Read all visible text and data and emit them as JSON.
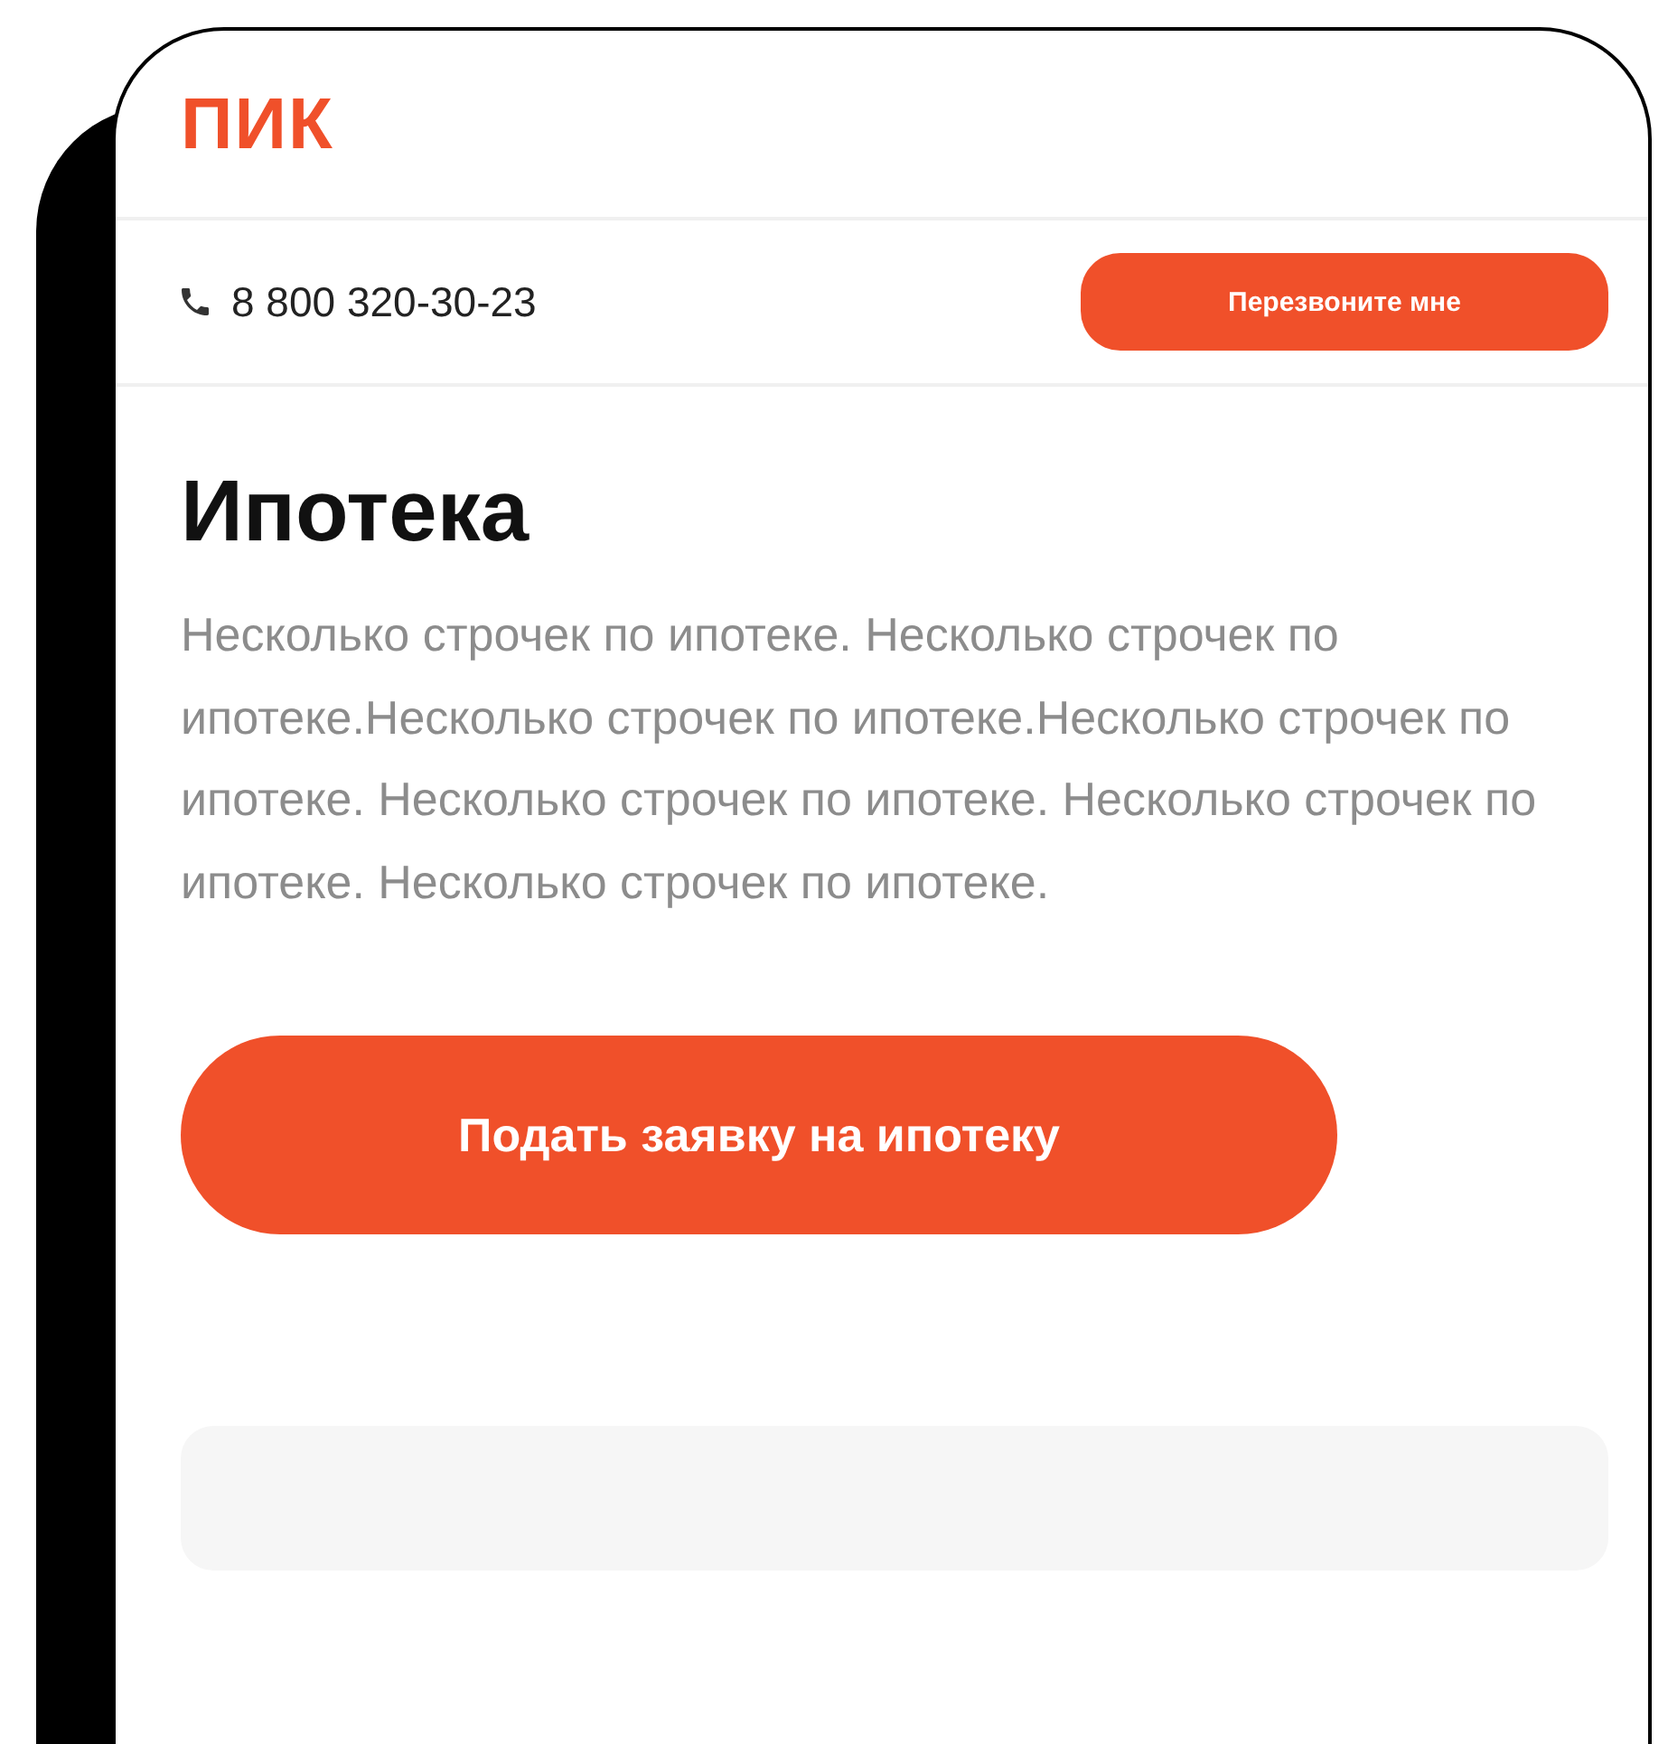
{
  "header": {
    "logo": "ПИК"
  },
  "contact_bar": {
    "phone": "8 800 320-30-23",
    "callback_button": "Перезвоните мне"
  },
  "content": {
    "title": "Ипотека",
    "description": "Несколько строчек по ипотеке. Несколько строчек по ипотеке.Несколько строчек по ипотеке.Несколько строчек по ипотеке. Несколько строчек по ипотеке. Несколько строчек по ипотеке. Несколько строчек по ипотеке.",
    "apply_button": "Подать заявку на ипотеку"
  }
}
